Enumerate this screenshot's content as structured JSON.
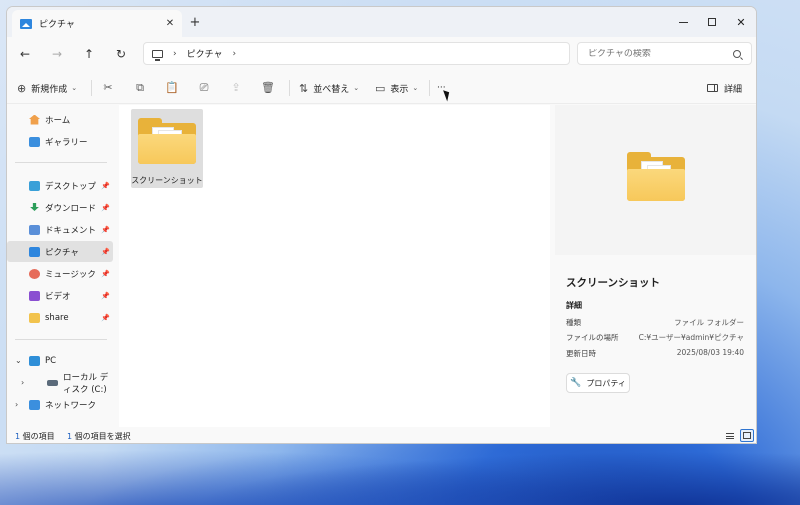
{
  "tab": {
    "title": "ピクチャ",
    "close": "✕"
  },
  "new_tab": "+",
  "window_controls": {
    "minimize": "minimize",
    "maximize": "maximize",
    "close": "✕"
  },
  "nav": {
    "back": "←",
    "forward": "→",
    "up": "↑",
    "refresh": "↻"
  },
  "address": {
    "root_icon": "monitor-icon",
    "separator": "›",
    "crumbs": [
      "ピクチャ"
    ]
  },
  "search": {
    "placeholder": "ピクチャの検索"
  },
  "toolbar": {
    "new_label": "新規作成",
    "sort_label": "並べ替え",
    "view_label": "表示",
    "more_label": "···",
    "details_label": "詳細"
  },
  "sidebar": {
    "home": "ホーム",
    "gallery": "ギャラリー",
    "quick": [
      {
        "label": "デスクトップ",
        "icon": "desktop-icon"
      },
      {
        "label": "ダウンロード",
        "icon": "download-icon"
      },
      {
        "label": "ドキュメント",
        "icon": "documents-icon"
      },
      {
        "label": "ピクチャ",
        "icon": "pictures-icon",
        "selected": true
      },
      {
        "label": "ミュージック",
        "icon": "music-icon"
      },
      {
        "label": "ビデオ",
        "icon": "video-icon"
      },
      {
        "label": "share",
        "icon": "folder-icon"
      }
    ],
    "pc": "PC",
    "local_disk": "ローカル ディスク (C:)",
    "network": "ネットワーク"
  },
  "content": {
    "items": [
      {
        "name": "スクリーンショット",
        "type": "folder",
        "selected": true
      }
    ]
  },
  "details": {
    "title": "スクリーンショット",
    "section": "詳細",
    "props": [
      {
        "key": "種類",
        "value": "ファイル フォルダー"
      },
      {
        "key": "ファイルの場所",
        "value": "C:¥ユーザー¥admin¥ピクチャ"
      },
      {
        "key": "更新日時",
        "value": "2025/08/03 19:40"
      }
    ],
    "properties_button": "プロパティ"
  },
  "status": {
    "count_num": "1",
    "count_text": "個の項目",
    "selected_num": "1",
    "selected_text": "個の項目を選択"
  },
  "colors": {
    "accent": "#2f74d0",
    "folder": "#f7c85a",
    "selection": "#e1e1e1"
  }
}
